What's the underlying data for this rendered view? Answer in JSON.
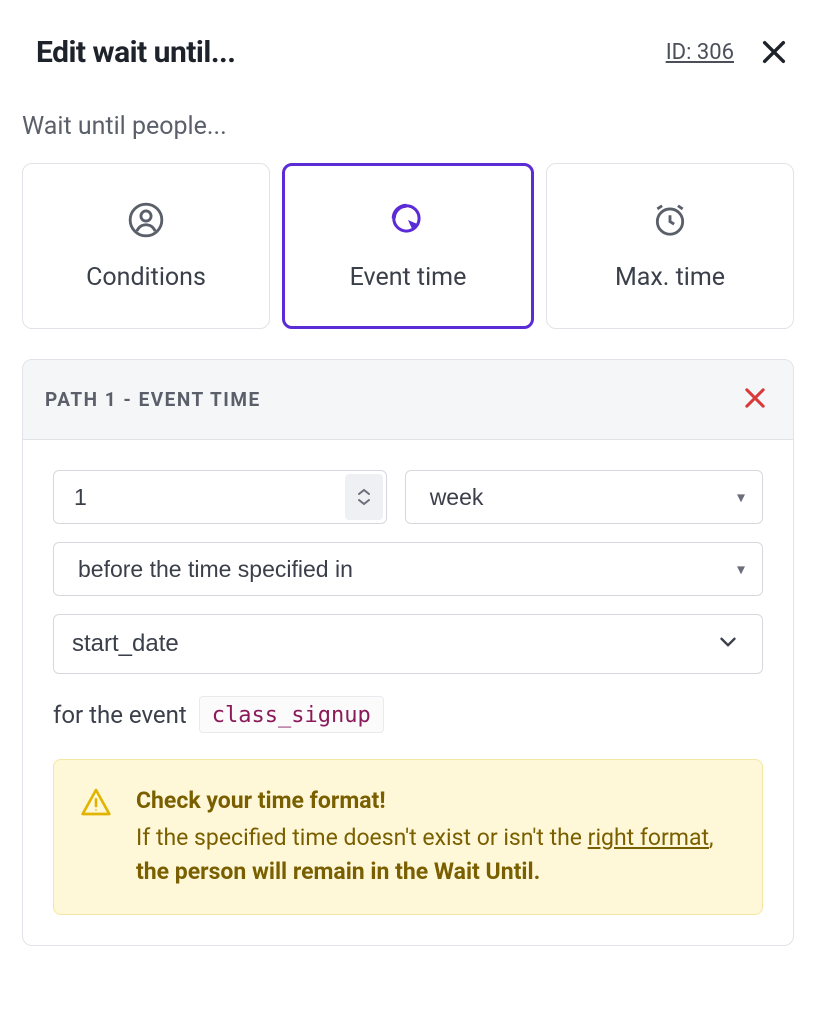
{
  "header": {
    "title": "Edit wait until...",
    "id_label": "ID: 306"
  },
  "subhead": "Wait until people...",
  "tabs": {
    "conditions": "Conditions",
    "event_time": "Event time",
    "max_time": "Max. time",
    "active": "event_time"
  },
  "path": {
    "title": "Path 1 - Event Time",
    "quantity": "1",
    "unit": "week",
    "relation": "before the time specified in",
    "attribute": "start_date",
    "event_prefix": "for the event",
    "event_name": "class_signup"
  },
  "warning": {
    "title": "Check your time format!",
    "lead": "If the specified time doesn't exist or isn't the ",
    "link": "right format",
    "after_link": ", ",
    "strong": "the person will remain in the Wait Until."
  }
}
